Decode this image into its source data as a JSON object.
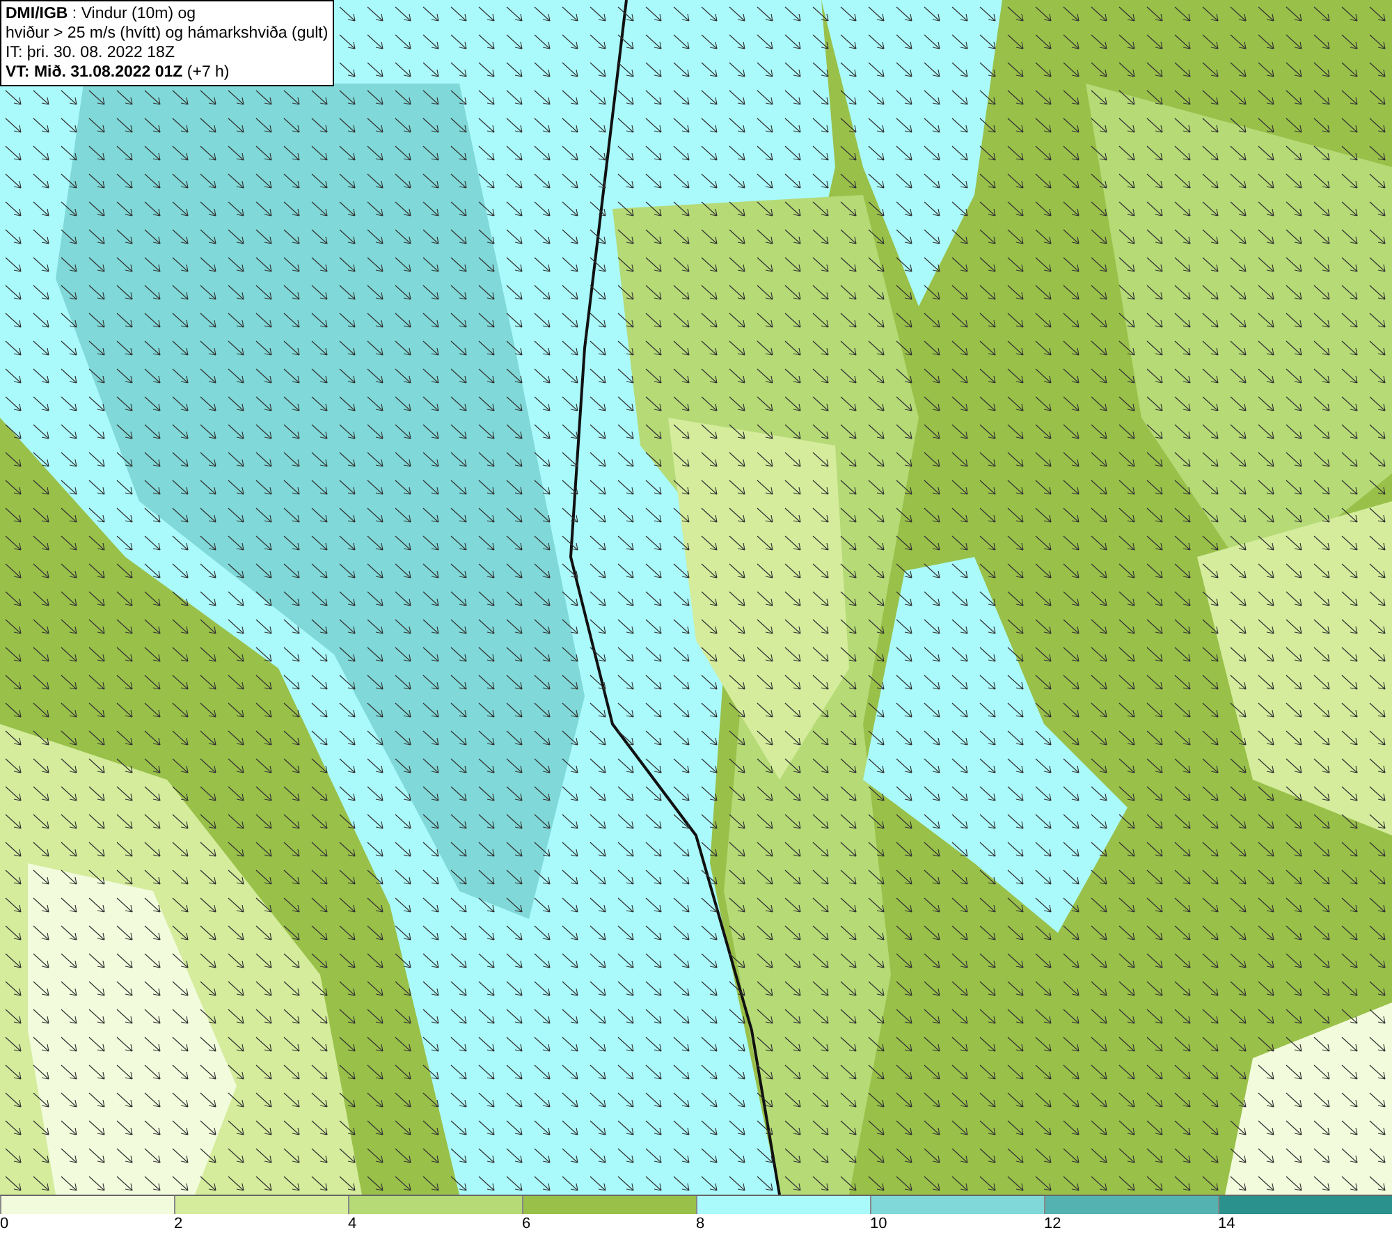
{
  "info_box": {
    "lines": [
      "**DMI/IGB** : Vindur (10m) og",
      "hviður > 25 m/s (hvítt) og hámarkshviða (gult)",
      "IT: þri. 30. 08. 2022 18Z",
      "**VT: Mið. 31.08.2022 01Z** (+7 h)"
    ]
  },
  "legend": [
    {
      "label": "0",
      "color": "#f2fbdc"
    },
    {
      "label": "2",
      "color": "#d4ec9c"
    },
    {
      "label": "4",
      "color": "#b5da76"
    },
    {
      "label": "6",
      "color": "#99c049"
    },
    {
      "label": "8",
      "color": "#aaf9fb"
    },
    {
      "label": "10",
      "color": "#80d8d8"
    },
    {
      "label": "12",
      "color": "#54b3b0"
    },
    {
      "label": "14",
      "color": "#2a918c"
    }
  ]
}
